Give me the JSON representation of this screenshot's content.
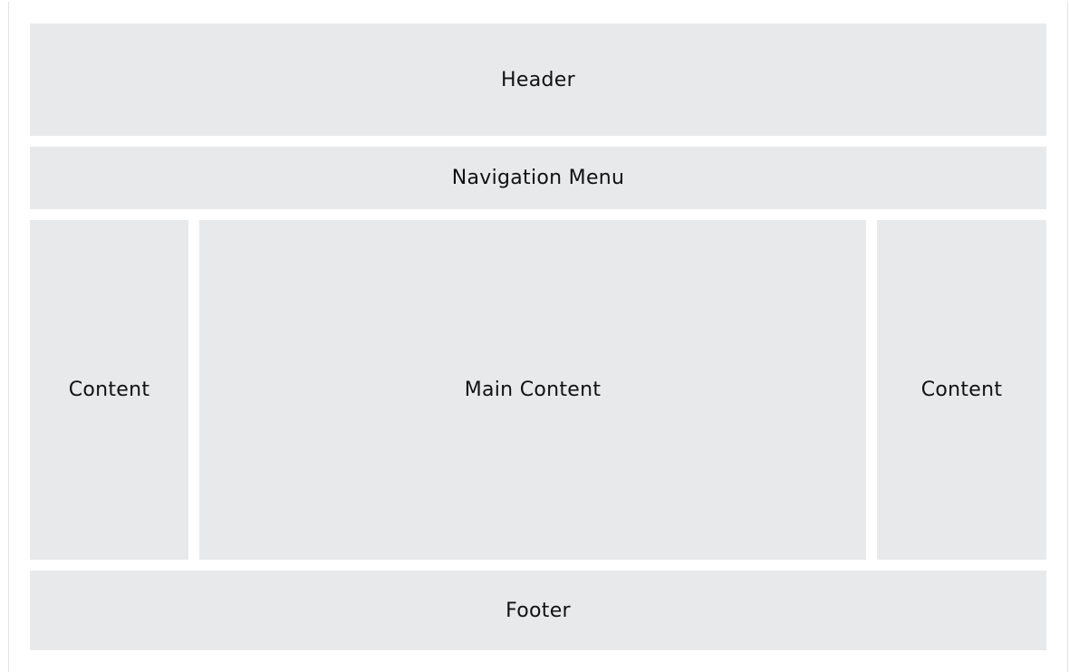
{
  "layout": {
    "header": "Header",
    "navigation": "Navigation Menu",
    "left_sidebar": "Content",
    "main": "Main Content",
    "right_sidebar": "Content",
    "footer": "Footer"
  },
  "colors": {
    "background": "#ffffff",
    "box_fill": "#e8e9eb",
    "text": "#111111"
  }
}
